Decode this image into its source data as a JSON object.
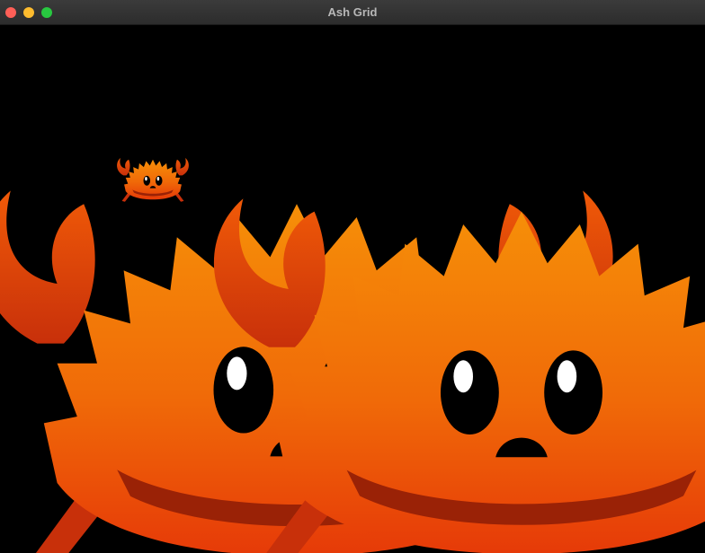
{
  "window": {
    "title": "Ash Grid",
    "controls": [
      "close",
      "minimize",
      "zoom"
    ]
  },
  "scene": {
    "background": "#000000",
    "sprite": "ferris-crab",
    "sprite_count": 3,
    "colors": {
      "body_top": "#f48a08",
      "body_bottom": "#e83b08",
      "claw": "#e03c08",
      "shadow": "#9a2206",
      "eye": "#000000",
      "eye_shine": "#ffffff"
    }
  }
}
